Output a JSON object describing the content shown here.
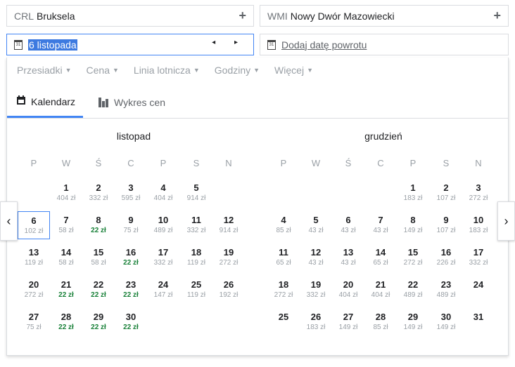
{
  "origin": {
    "code": "CRL",
    "city": "Bruksela",
    "add": "+"
  },
  "destination": {
    "code": "WMI",
    "city": "Nowy Dwór Mazowiecki",
    "add": "+"
  },
  "depart": {
    "icon_text": "31",
    "value": "6 listopada",
    "arrows": "◂ ▸"
  },
  "return": {
    "icon_text": "31",
    "placeholder": "Dodaj datę powrotu"
  },
  "filters": [
    "Przesiadki",
    "Cena",
    "Linia lotnicza",
    "Godziny",
    "Więcej"
  ],
  "tabs": {
    "calendar": "Kalendarz",
    "chart": "Wykres cen"
  },
  "nav": {
    "prev": "‹",
    "next": "›"
  },
  "weekdays": [
    "P",
    "W",
    "Ś",
    "C",
    "P",
    "S",
    "N"
  ],
  "accent_color": "#4285f4",
  "cheap_color": "#188038",
  "months": [
    {
      "name": "listopad",
      "days": [
        {
          "d": "1",
          "p": "404 zł",
          "col": 1,
          "row": 0
        },
        {
          "d": "2",
          "p": "332 zł",
          "col": 2,
          "row": 0
        },
        {
          "d": "3",
          "p": "595 zł",
          "col": 3,
          "row": 0
        },
        {
          "d": "4",
          "p": "404 zł",
          "col": 4,
          "row": 0
        },
        {
          "d": "5",
          "p": "914 zł",
          "col": 5,
          "row": 0
        },
        {
          "d": "6",
          "p": "102 zł",
          "col": 0,
          "row": 1,
          "sel": true
        },
        {
          "d": "7",
          "p": "58 zł",
          "col": 1,
          "row": 1
        },
        {
          "d": "8",
          "p": "22 zł",
          "col": 2,
          "row": 1,
          "cheap": true
        },
        {
          "d": "9",
          "p": "75 zł",
          "col": 3,
          "row": 1
        },
        {
          "d": "10",
          "p": "489 zł",
          "col": 4,
          "row": 1
        },
        {
          "d": "11",
          "p": "332 zł",
          "col": 5,
          "row": 1
        },
        {
          "d": "12",
          "p": "914 zł",
          "col": 6,
          "row": 1
        },
        {
          "d": "13",
          "p": "119 zł",
          "col": 0,
          "row": 2
        },
        {
          "d": "14",
          "p": "58 zł",
          "col": 1,
          "row": 2
        },
        {
          "d": "15",
          "p": "58 zł",
          "col": 2,
          "row": 2
        },
        {
          "d": "16",
          "p": "22 zł",
          "col": 3,
          "row": 2,
          "cheap": true
        },
        {
          "d": "17",
          "p": "332 zł",
          "col": 4,
          "row": 2
        },
        {
          "d": "18",
          "p": "119 zł",
          "col": 5,
          "row": 2
        },
        {
          "d": "19",
          "p": "272 zł",
          "col": 6,
          "row": 2
        },
        {
          "d": "20",
          "p": "272 zł",
          "col": 0,
          "row": 3
        },
        {
          "d": "21",
          "p": "22 zł",
          "col": 1,
          "row": 3,
          "cheap": true
        },
        {
          "d": "22",
          "p": "22 zł",
          "col": 2,
          "row": 3,
          "cheap": true
        },
        {
          "d": "23",
          "p": "22 zł",
          "col": 3,
          "row": 3,
          "cheap": true
        },
        {
          "d": "24",
          "p": "147 zł",
          "col": 4,
          "row": 3
        },
        {
          "d": "25",
          "p": "119 zł",
          "col": 5,
          "row": 3
        },
        {
          "d": "26",
          "p": "192 zł",
          "col": 6,
          "row": 3
        },
        {
          "d": "27",
          "p": "75 zł",
          "col": 0,
          "row": 4
        },
        {
          "d": "28",
          "p": "22 zł",
          "col": 1,
          "row": 4,
          "cheap": true
        },
        {
          "d": "29",
          "p": "22 zł",
          "col": 2,
          "row": 4,
          "cheap": true
        },
        {
          "d": "30",
          "p": "22 zł",
          "col": 3,
          "row": 4,
          "cheap": true
        }
      ]
    },
    {
      "name": "grudzień",
      "days": [
        {
          "d": "1",
          "p": "183 zł",
          "col": 4,
          "row": 0
        },
        {
          "d": "2",
          "p": "107 zł",
          "col": 5,
          "row": 0
        },
        {
          "d": "3",
          "p": "272 zł",
          "col": 6,
          "row": 0
        },
        {
          "d": "4",
          "p": "85 zł",
          "col": 0,
          "row": 1
        },
        {
          "d": "5",
          "p": "43 zł",
          "col": 1,
          "row": 1
        },
        {
          "d": "6",
          "p": "43 zł",
          "col": 2,
          "row": 1
        },
        {
          "d": "7",
          "p": "43 zł",
          "col": 3,
          "row": 1
        },
        {
          "d": "8",
          "p": "149 zł",
          "col": 4,
          "row": 1
        },
        {
          "d": "9",
          "p": "107 zł",
          "col": 5,
          "row": 1
        },
        {
          "d": "10",
          "p": "183 zł",
          "col": 6,
          "row": 1
        },
        {
          "d": "11",
          "p": "65 zł",
          "col": 0,
          "row": 2
        },
        {
          "d": "12",
          "p": "43 zł",
          "col": 1,
          "row": 2
        },
        {
          "d": "13",
          "p": "43 zł",
          "col": 2,
          "row": 2
        },
        {
          "d": "14",
          "p": "65 zł",
          "col": 3,
          "row": 2
        },
        {
          "d": "15",
          "p": "272 zł",
          "col": 4,
          "row": 2
        },
        {
          "d": "16",
          "p": "226 zł",
          "col": 5,
          "row": 2
        },
        {
          "d": "17",
          "p": "332 zł",
          "col": 6,
          "row": 2
        },
        {
          "d": "18",
          "p": "272 zł",
          "col": 0,
          "row": 3
        },
        {
          "d": "19",
          "p": "332 zł",
          "col": 1,
          "row": 3
        },
        {
          "d": "20",
          "p": "404 zł",
          "col": 2,
          "row": 3
        },
        {
          "d": "21",
          "p": "404 zł",
          "col": 3,
          "row": 3
        },
        {
          "d": "22",
          "p": "489 zł",
          "col": 4,
          "row": 3
        },
        {
          "d": "23",
          "p": "489 zł",
          "col": 5,
          "row": 3
        },
        {
          "d": "24",
          "p": "",
          "col": 6,
          "row": 3
        },
        {
          "d": "25",
          "p": "",
          "col": 0,
          "row": 4
        },
        {
          "d": "26",
          "p": "183 zł",
          "col": 1,
          "row": 4
        },
        {
          "d": "27",
          "p": "149 zł",
          "col": 2,
          "row": 4
        },
        {
          "d": "28",
          "p": "85 zł",
          "col": 3,
          "row": 4
        },
        {
          "d": "29",
          "p": "149 zł",
          "col": 4,
          "row": 4
        },
        {
          "d": "30",
          "p": "149 zł",
          "col": 5,
          "row": 4
        },
        {
          "d": "31",
          "p": "",
          "col": 6,
          "row": 4
        }
      ]
    }
  ]
}
